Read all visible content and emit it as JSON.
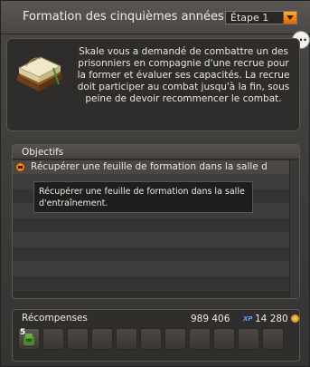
{
  "header": {
    "title": "Formation des cinquièmes années",
    "step_label": "Étape 1",
    "more_label": "..."
  },
  "description": {
    "icon": "quest-book-icon",
    "text": "Skale vous a demandé de combattre un des prisonniers en compagnie d'une recrue pour la former et évaluer ses capacités. La recrue doit participer au combat jusqu'à la fin, sous peine de devoir recommencer le combat."
  },
  "objectives": {
    "title": "Objectifs",
    "items": [
      {
        "label": "Récupérer une feuille de formation dans la salle d...",
        "status_icon": "objective-pending-icon"
      }
    ],
    "tooltip": "Récupérer une feuille de formation dans la salle d'entraînement."
  },
  "rewards": {
    "title": "Récompenses",
    "xp": "989 406",
    "xp_unit": "XP",
    "kamas": "14 280",
    "kamas_icon": "kama-coin-icon",
    "items": [
      {
        "icon": "item-bag-icon",
        "count": "5"
      }
    ],
    "empty_slots": 10
  },
  "colors": {
    "accent": "#f08a10",
    "xp": "#5aa0ff"
  }
}
